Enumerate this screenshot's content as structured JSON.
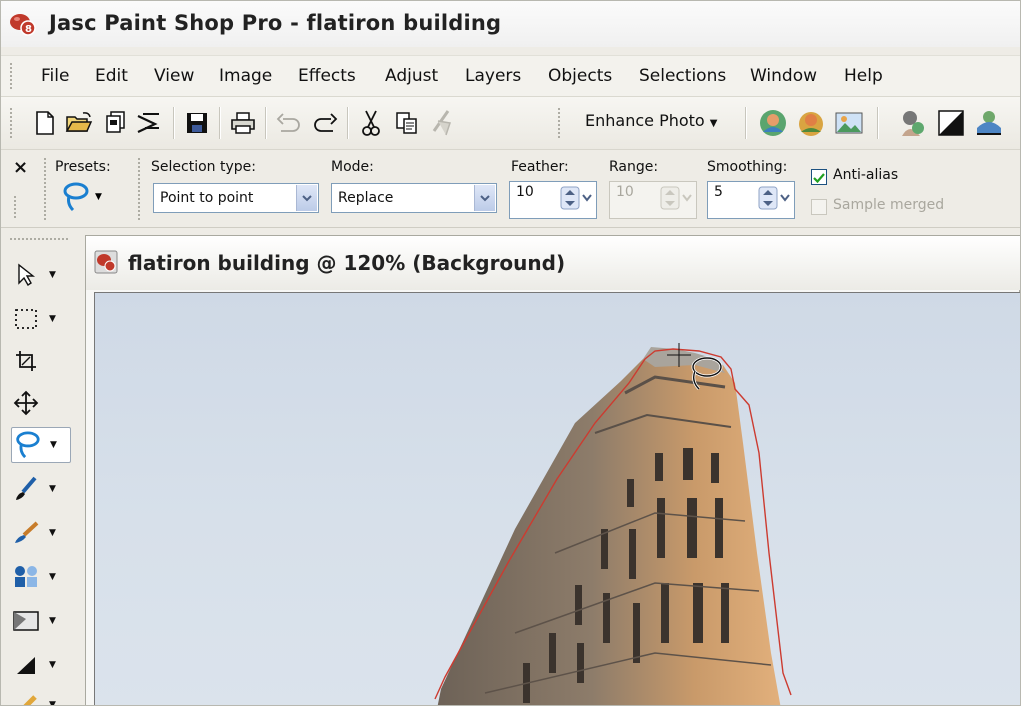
{
  "window": {
    "title": "Jasc Paint Shop Pro - flatiron building"
  },
  "menu": [
    "File",
    "Edit",
    "View",
    "Image",
    "Effects",
    "Adjust",
    "Layers",
    "Objects",
    "Selections",
    "Window",
    "Help"
  ],
  "toolbar": {
    "enhance_photo_label": "Enhance Photo"
  },
  "options": {
    "close": "×",
    "presets_label": "Presets:",
    "selection_type_label": "Selection type:",
    "selection_type_value": "Point to point",
    "mode_label": "Mode:",
    "mode_value": "Replace",
    "feather_label": "Feather:",
    "feather_value": "10",
    "range_label": "Range:",
    "range_value": "10",
    "smoothing_label": "Smoothing:",
    "smoothing_value": "5",
    "antialias_label": "Anti-alias",
    "antialias_checked": true,
    "sample_merged_label": "Sample merged",
    "sample_merged_checked": false
  },
  "image_window": {
    "title": "flatiron building @ 120% (Background)"
  },
  "colors": {
    "sky": "#d4dde8",
    "selection_marquee": "#c0392b",
    "building": "#9c8a78"
  }
}
